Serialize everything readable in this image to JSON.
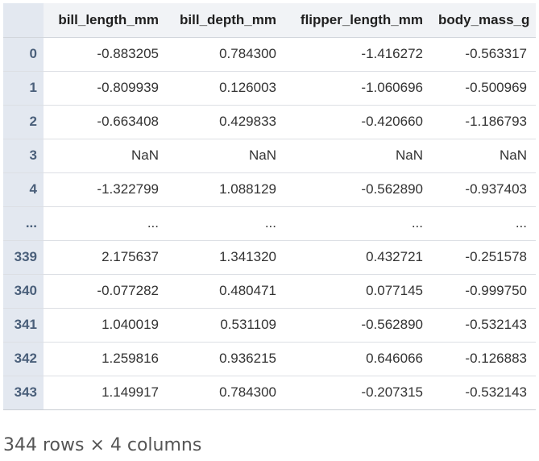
{
  "table": {
    "columns": [
      "bill_length_mm",
      "bill_depth_mm",
      "flipper_length_mm",
      "body_mass_g"
    ],
    "rows": [
      {
        "index": "0",
        "cells": [
          "-0.883205",
          "0.784300",
          "-1.416272",
          "-0.563317"
        ]
      },
      {
        "index": "1",
        "cells": [
          "-0.809939",
          "0.126003",
          "-1.060696",
          "-0.500969"
        ]
      },
      {
        "index": "2",
        "cells": [
          "-0.663408",
          "0.429833",
          "-0.420660",
          "-1.186793"
        ]
      },
      {
        "index": "3",
        "cells": [
          "NaN",
          "NaN",
          "NaN",
          "NaN"
        ]
      },
      {
        "index": "4",
        "cells": [
          "-1.322799",
          "1.088129",
          "-0.562890",
          "-0.937403"
        ]
      },
      {
        "index": "...",
        "cells": [
          "...",
          "...",
          "...",
          "..."
        ]
      },
      {
        "index": "339",
        "cells": [
          "2.175637",
          "1.341320",
          "0.432721",
          "-0.251578"
        ]
      },
      {
        "index": "340",
        "cells": [
          "-0.077282",
          "0.480471",
          "0.077145",
          "-0.999750"
        ]
      },
      {
        "index": "341",
        "cells": [
          "1.040019",
          "0.531109",
          "-0.562890",
          "-0.532143"
        ]
      },
      {
        "index": "342",
        "cells": [
          "1.259816",
          "0.936215",
          "0.646066",
          "-0.126883"
        ]
      },
      {
        "index": "343",
        "cells": [
          "1.149917",
          "0.784300",
          "-0.207315",
          "-0.532143"
        ]
      }
    ]
  },
  "footer": {
    "shape_text": "344 rows × 4 columns"
  }
}
